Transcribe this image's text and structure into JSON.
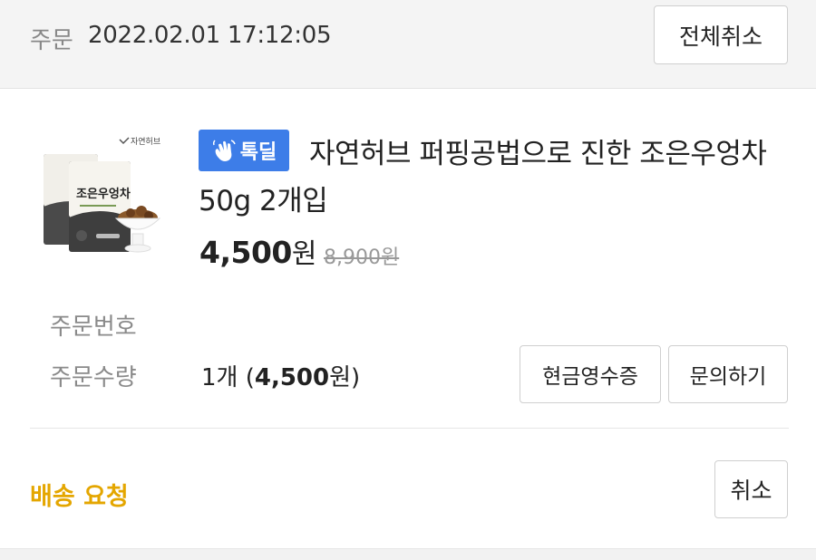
{
  "header": {
    "date_label": "주문",
    "date_value": "2022.02.01 17:12:05",
    "cancel_all_label": "전체취소"
  },
  "product": {
    "thumbnail_icon": "product-package-image",
    "thumbnail_brand_text": "자연허브",
    "thumbnail_pack_text": "조은우엉차",
    "badge_label": "톡딜",
    "badge_icon": "waving-hand-icon",
    "title": "자연허브 퍼핑공법으로 진한 조은우엉차50g 2개입",
    "price": "4,500",
    "price_unit": "원",
    "original_price": "8,900원"
  },
  "details": {
    "order_number_label": "주문번호",
    "quantity_label": "주문수량",
    "quantity_prefix": "1개 (",
    "quantity_amount": "4,500",
    "quantity_suffix": "원)",
    "receipt_button_label": "현금영수증",
    "inquiry_button_label": "문의하기"
  },
  "shipping": {
    "status": "배송 요청",
    "status_color": "#e4a600",
    "cancel_label": "취소"
  },
  "colors": {
    "badge_bg": "#3d7de8",
    "header_bg": "#f4f4f4"
  }
}
